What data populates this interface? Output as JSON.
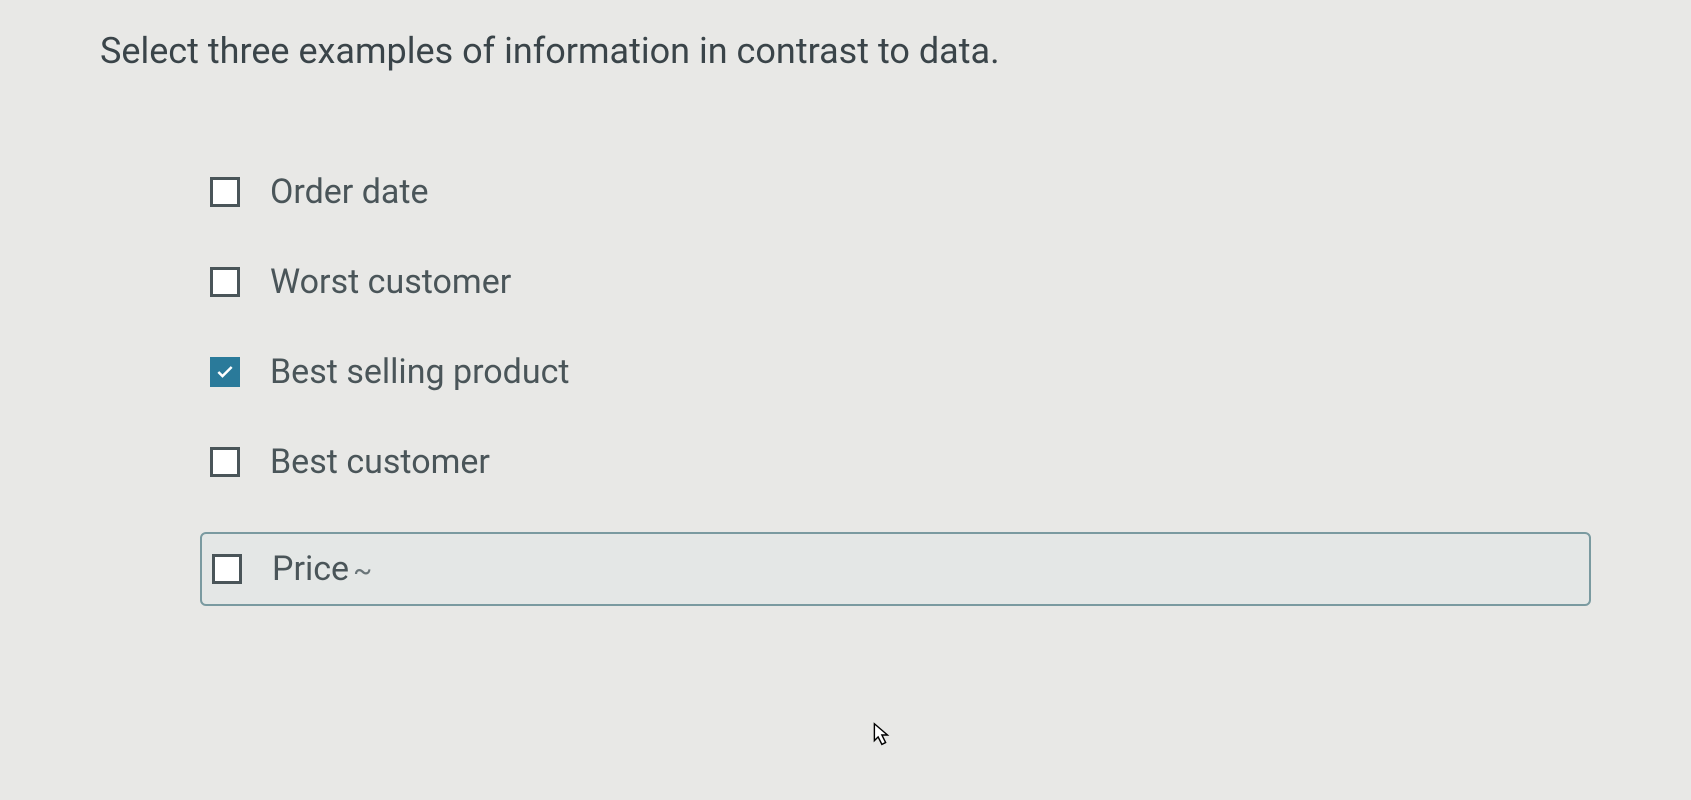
{
  "question": {
    "prompt": "Select three examples of information in contrast to data."
  },
  "options": [
    {
      "id": "order-date",
      "label": "Order date",
      "checked": false,
      "highlighted": false
    },
    {
      "id": "worst-customer",
      "label": "Worst customer",
      "checked": false,
      "highlighted": false
    },
    {
      "id": "best-selling-product",
      "label": "Best selling product",
      "checked": true,
      "highlighted": false
    },
    {
      "id": "best-customer",
      "label": "Best customer",
      "checked": false,
      "highlighted": false
    },
    {
      "id": "price",
      "label": "Price",
      "suffix": "~",
      "checked": false,
      "highlighted": true
    }
  ]
}
